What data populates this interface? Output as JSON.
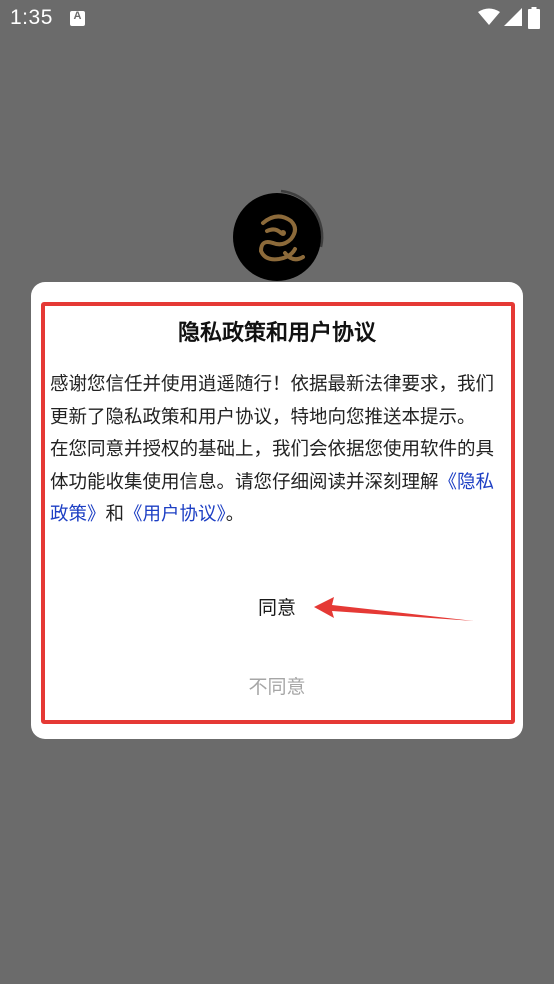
{
  "status_bar": {
    "time": "1:35",
    "icons": [
      "a-notification-icon",
      "wifi-icon",
      "signal-icon",
      "battery-icon"
    ]
  },
  "app": {
    "logo": "dragon-logo-icon"
  },
  "dialog": {
    "title": "隐私政策和用户协议",
    "body_line1": "感谢您信任并使用逍遥随行！依据最新法律要求，我们更新了隐私政策和用户协议，特地向您推送本提示。",
    "body_line2_prefix": "在您同意并授权的基础上，我们会依据您使用软件的具体功能收集使用信息。请您仔细阅读并深刻理解",
    "privacy_link": "《隐私政策》",
    "and_text": "和",
    "terms_link": "《用户协议》",
    "body_line2_suffix": "。",
    "agree_label": "同意",
    "disagree_label": "不同意"
  },
  "colors": {
    "overlay_bg": "#6b6b6b",
    "highlight_border": "#e53935",
    "link": "#1d3fc4",
    "disagree_text": "#a6a6a6"
  }
}
